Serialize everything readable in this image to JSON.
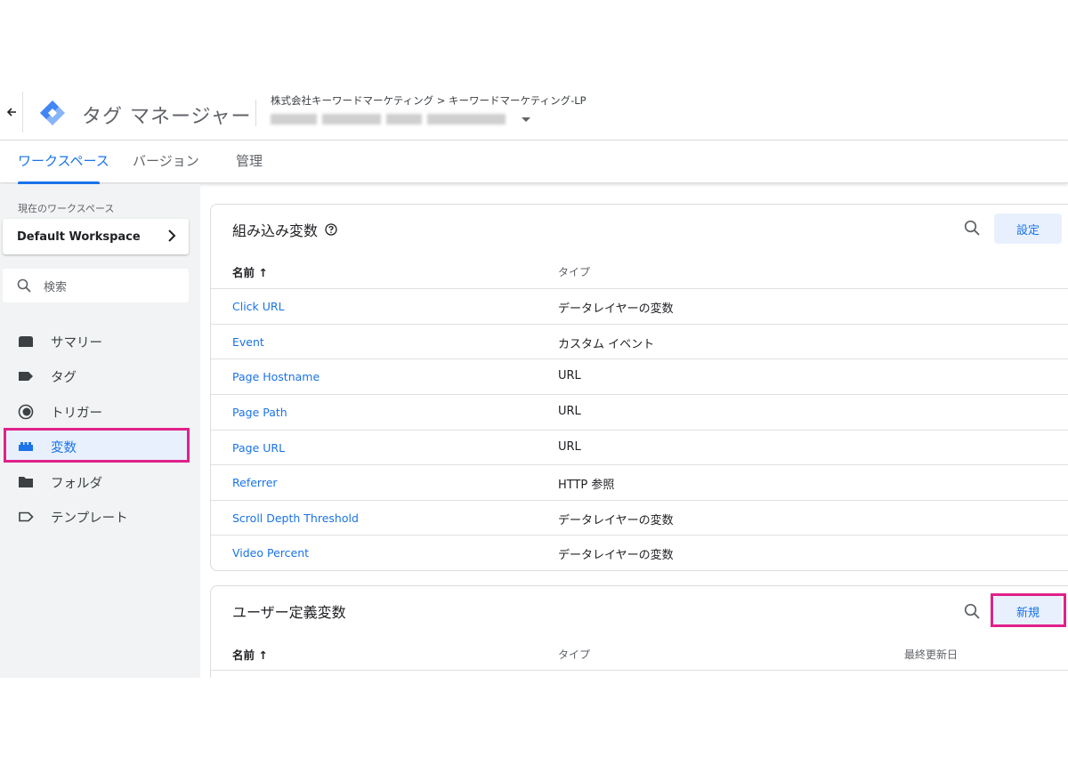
{
  "header": {
    "product_name": "タグ マネージャー",
    "breadcrumb": "株式会社キーワードマーケティング > キーワードマーケティング-LP"
  },
  "tabs": [
    {
      "label": "ワークスペース",
      "active": true
    },
    {
      "label": "バージョン",
      "active": false
    },
    {
      "label": "管理",
      "active": false
    }
  ],
  "sidebar": {
    "workspace_label": "現在のワークスペース",
    "workspace_name": "Default Workspace",
    "search_placeholder": "検索",
    "items": [
      {
        "label": "サマリー",
        "icon": "folder-tab-icon"
      },
      {
        "label": "タグ",
        "icon": "tag-icon"
      },
      {
        "label": "トリガー",
        "icon": "trigger-icon"
      },
      {
        "label": "変数",
        "icon": "variables-icon",
        "active": true
      },
      {
        "label": "フォルダ",
        "icon": "folder-icon"
      },
      {
        "label": "テンプレート",
        "icon": "template-icon"
      }
    ]
  },
  "builtin": {
    "title": "組み込み変数",
    "settings_label": "設定",
    "col_name": "名前 ↑",
    "col_type": "タイプ",
    "rows": [
      {
        "name": "Click URL",
        "type": "データレイヤーの変数"
      },
      {
        "name": "Event",
        "type": "カスタム イベント"
      },
      {
        "name": "Page Hostname",
        "type": "URL"
      },
      {
        "name": "Page Path",
        "type": "URL"
      },
      {
        "name": "Page URL",
        "type": "URL"
      },
      {
        "name": "Referrer",
        "type": "HTTP 参照"
      },
      {
        "name": "Scroll Depth Threshold",
        "type": "データレイヤーの変数"
      },
      {
        "name": "Video Percent",
        "type": "データレイヤーの変数"
      }
    ]
  },
  "user_defined": {
    "title": "ユーザー定義変数",
    "new_label": "新規",
    "col_name": "名前 ↑",
    "col_type": "タイプ",
    "col_updated": "最終更新日"
  },
  "colors": {
    "accent": "#1a73e8",
    "highlight": "#e0218a",
    "sidebar_bg": "#f1f3f4"
  }
}
